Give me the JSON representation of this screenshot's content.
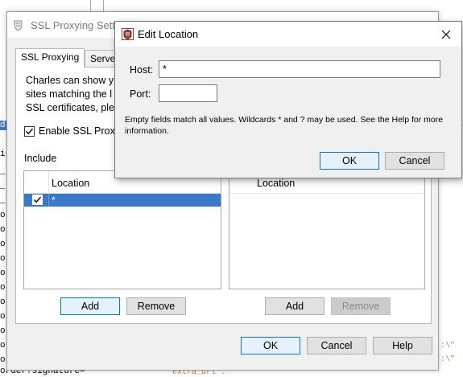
{
  "background": {
    "left_fragments": [
      "d",
      "is",
      "_",
      "_",
      "_",
      "or",
      "or",
      "or",
      "or",
      "or",
      "or",
      "or",
      "or",
      "or",
      "or",
      "or"
    ],
    "bottom_text": "order?signature=",
    "code_text": "\"extra_url\": \"\"",
    "right_fragments": [
      "e\"",
      ":\\\"",
      ":\\\""
    ]
  },
  "main_window": {
    "title": "SSL Proxying Setti",
    "tabs": [
      {
        "label": "SSL Proxying",
        "active": true
      },
      {
        "label": "Serve",
        "active": false
      }
    ],
    "description": [
      "Charles can show y",
      "sites matching the l",
      "SSL certificates, ple"
    ],
    "enable_label": "Enable SSL Proxy",
    "enable_checked": true,
    "include": {
      "label": "Include",
      "column": "Location",
      "rows": [
        {
          "checked": true,
          "location": "*"
        }
      ],
      "add_label": "Add",
      "remove_label": "Remove"
    },
    "exclude": {
      "column": "Location",
      "rows": [],
      "add_label": "Add",
      "remove_label": "Remove"
    },
    "ok_label": "OK",
    "cancel_label": "Cancel",
    "help_label": "Help"
  },
  "edit_dialog": {
    "title": "Edit Location",
    "host_label": "Host:",
    "host_value": "*",
    "port_label": "Port:",
    "port_value": "",
    "note": "Empty fields match all values. Wildcards * and ? may be used. See the Help for more information.",
    "ok_label": "OK",
    "cancel_label": "Cancel"
  },
  "colors": {
    "selection": "#3a79c9",
    "window_bg": "#f0f0f0",
    "default_button_border": "#0078d7"
  }
}
